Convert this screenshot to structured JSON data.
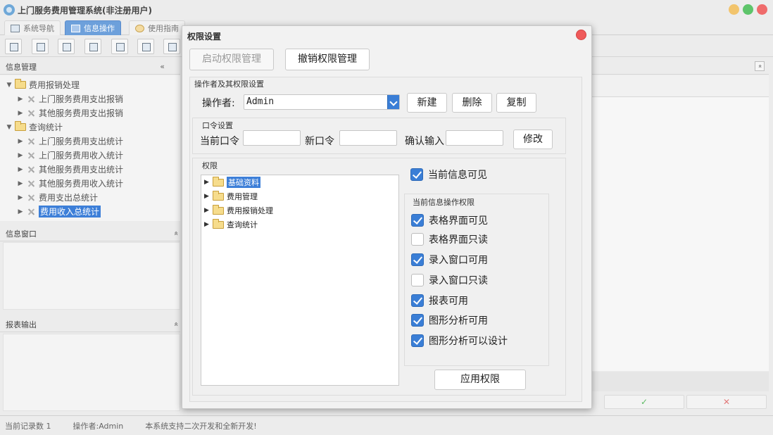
{
  "app": {
    "title": "上门服务费用管理系统(非注册用户)",
    "tabs": [
      {
        "label": "系统导航"
      },
      {
        "label": "信息操作"
      },
      {
        "label": "使用指南"
      }
    ]
  },
  "left_panel": {
    "info_mgmt_title": "信息管理",
    "collapse_glyph": "«",
    "tree": [
      {
        "label": "费用报销处理"
      },
      {
        "label": "上门服务费用支出报销"
      },
      {
        "label": "其他服务费用支出报销"
      },
      {
        "label": "查询统计"
      },
      {
        "label": "上门服务费用支出统计"
      },
      {
        "label": "上门服务费用收入统计"
      },
      {
        "label": "其他服务费用支出统计"
      },
      {
        "label": "其他服务费用收入统计"
      },
      {
        "label": "费用支出总统计"
      },
      {
        "label": "费用收入总统计"
      }
    ],
    "info_window_title": "信息窗口",
    "report_output_title": "报表输出",
    "expand_glyph": "«"
  },
  "right_panel": {
    "collapse_glyph": "«",
    "ok_glyph": "✓",
    "cancel_glyph": "✕"
  },
  "status": {
    "record_count": "当前记录数 1",
    "operator": "操作者:Admin",
    "note": "本系统支持二次开发和全新开发!"
  },
  "dialog": {
    "title": "权限设置",
    "enable_btn": "启动权限管理",
    "revoke_btn": "撤销权限管理",
    "operator_group": "操作者及其权限设置",
    "operator_label": "操作者:",
    "operator_value": "Admin",
    "new_btn": "新建",
    "delete_btn": "删除",
    "copy_btn": "复制",
    "pwd_group": "口令设置",
    "current_pwd_label": "当前口令",
    "new_pwd_label": "新口令",
    "confirm_label": "确认输入",
    "modify_btn": "修改",
    "perm_group": "权限",
    "perm_tree": [
      {
        "label": "基础资料"
      },
      {
        "label": "费用管理"
      },
      {
        "label": "费用报销处理"
      },
      {
        "label": "查询统计"
      }
    ],
    "visible_label": "当前信息可见",
    "ops_group": "当前信息操作权限",
    "ops": [
      {
        "label": "表格界面可见",
        "checked": true
      },
      {
        "label": "表格界面只读",
        "checked": false
      },
      {
        "label": "录入窗口可用",
        "checked": true
      },
      {
        "label": "录入窗口只读",
        "checked": false
      },
      {
        "label": "报表可用",
        "checked": true
      },
      {
        "label": "图形分析可用",
        "checked": true
      },
      {
        "label": "图形分析可以设计",
        "checked": true
      }
    ],
    "apply_btn": "应用权限"
  }
}
